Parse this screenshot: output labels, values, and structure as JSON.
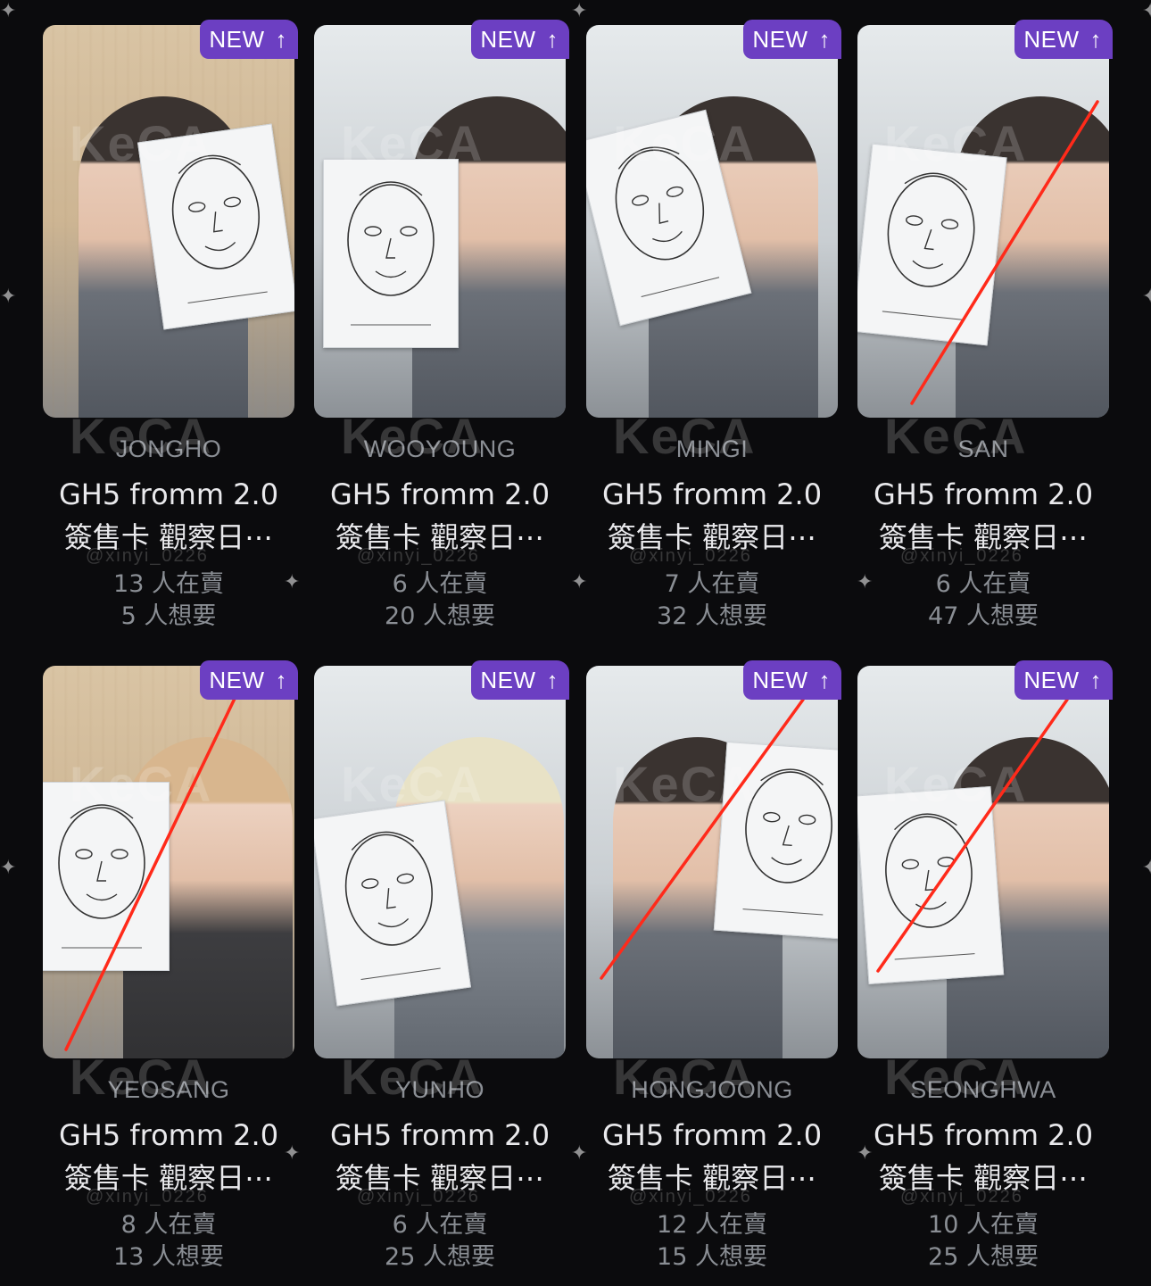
{
  "badge": {
    "label": "NEW",
    "icon": "arrow-up-icon",
    "color": "#6c3fc2"
  },
  "strike_color": "#ff2a1a",
  "watermark_text": "KeCA",
  "watermark_handle": "@xinyi_0226",
  "cards": [
    {
      "member": "JONGHO",
      "title_line1": "GH5 fromm 2.0",
      "title_line2": "簽售卡 觀察日⋯",
      "selling": "13 人在賣",
      "wanting": "5 人想要",
      "struck": false
    },
    {
      "member": "WOOYOUNG",
      "title_line1": "GH5 fromm 2.0",
      "title_line2": "簽售卡 觀察日⋯",
      "selling": "6 人在賣",
      "wanting": "20 人想要",
      "struck": false
    },
    {
      "member": "MINGI",
      "title_line1": "GH5 fromm 2.0",
      "title_line2": "簽售卡 觀察日⋯",
      "selling": "7 人在賣",
      "wanting": "32 人想要",
      "struck": false
    },
    {
      "member": "SAN",
      "title_line1": "GH5 fromm 2.0",
      "title_line2": "簽售卡 觀察日⋯",
      "selling": "6 人在賣",
      "wanting": "47 人想要",
      "struck": true
    },
    {
      "member": "YEOSANG",
      "title_line1": "GH5 fromm 2.0",
      "title_line2": "簽售卡 觀察日⋯",
      "selling": "8 人在賣",
      "wanting": "13 人想要",
      "struck": true
    },
    {
      "member": "YUNHO",
      "title_line1": "GH5 fromm 2.0",
      "title_line2": "簽售卡 觀察日⋯",
      "selling": "6 人在賣",
      "wanting": "25 人想要",
      "struck": false
    },
    {
      "member": "HONGJOONG",
      "title_line1": "GH5 fromm 2.0",
      "title_line2": "簽售卡 觀察日⋯",
      "selling": "12 人在賣",
      "wanting": "15 人想要",
      "struck": true
    },
    {
      "member": "SEONGHWA",
      "title_line1": "GH5 fromm 2.0",
      "title_line2": "簽售卡 觀察日⋯",
      "selling": "10 人在賣",
      "wanting": "25 人想要",
      "struck": true
    }
  ]
}
